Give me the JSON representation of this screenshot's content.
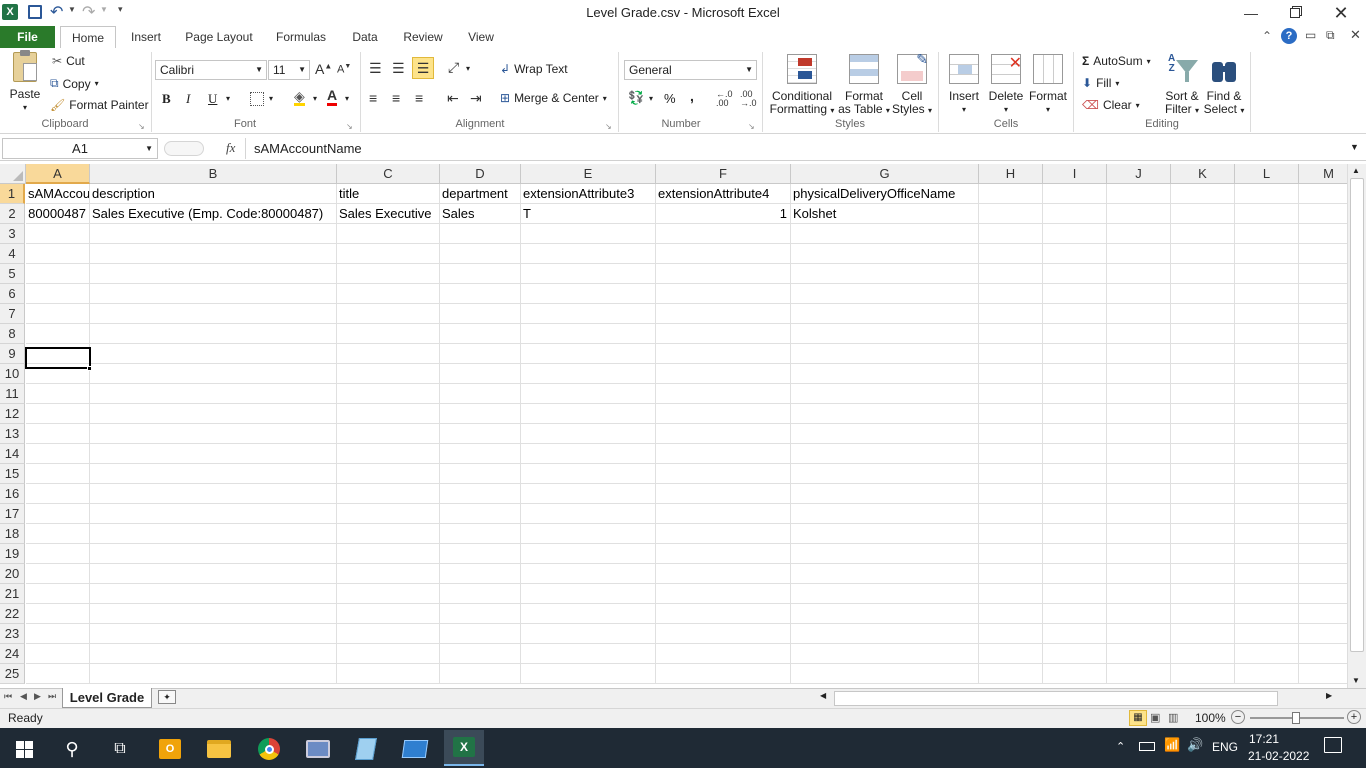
{
  "window": {
    "title": "Level Grade.csv  -  Microsoft Excel"
  },
  "tabs": [
    {
      "label": "File"
    },
    {
      "label": "Home"
    },
    {
      "label": "Insert"
    },
    {
      "label": "Page Layout"
    },
    {
      "label": "Formulas"
    },
    {
      "label": "Data"
    },
    {
      "label": "Review"
    },
    {
      "label": "View"
    }
  ],
  "ribbon": {
    "clipboard": {
      "paste": "Paste",
      "cut": "Cut",
      "copy": "Copy",
      "format_painter": "Format Painter",
      "label": "Clipboard"
    },
    "font": {
      "name": "Calibri",
      "size": "11",
      "bold": "B",
      "italic": "I",
      "underline": "U",
      "label": "Font"
    },
    "alignment": {
      "wrap": "Wrap Text",
      "merge": "Merge & Center",
      "label": "Alignment"
    },
    "number": {
      "format": "General",
      "percent": "%",
      "comma": ",",
      "label": "Number"
    },
    "styles": {
      "conditional": "Conditional",
      "conditional2": "Formatting",
      "format_table": "Format",
      "format_table2": "as Table",
      "cell_styles": "Cell",
      "cell_styles2": "Styles",
      "label": "Styles"
    },
    "cells": {
      "insert": "Insert",
      "delete": "Delete",
      "format": "Format",
      "label": "Cells"
    },
    "editing": {
      "autosum": "AutoSum",
      "fill": "Fill",
      "clear": "Clear",
      "sort": "Sort &",
      "sort2": "Filter",
      "find": "Find &",
      "find2": "Select",
      "label": "Editing"
    }
  },
  "formula_bar": {
    "name_box": "A1",
    "fx": "fx",
    "content": "sAMAccountName"
  },
  "columns": [
    "A",
    "B",
    "C",
    "D",
    "E",
    "F",
    "G",
    "H",
    "I",
    "J",
    "K",
    "L",
    "M"
  ],
  "rows": [
    "1",
    "2",
    "3",
    "4",
    "5",
    "6",
    "7",
    "8",
    "9",
    "10",
    "11",
    "12",
    "13",
    "14",
    "15",
    "16",
    "17",
    "18",
    "19",
    "20",
    "21",
    "22",
    "23",
    "24",
    "25"
  ],
  "cells": {
    "A1": "sAMAccou",
    "B1": "description",
    "C1": "title",
    "D1": "department",
    "E1": "extensionAttribute3",
    "F1": "extensionAttribute4",
    "G1": "physicalDeliveryOfficeName",
    "A2": "80000487",
    "B2": "Sales Executive (Emp. Code:80000487)",
    "C2": "Sales Executive",
    "D2": "Sales",
    "E2": "T",
    "F2": "1",
    "G2": "Kolshet"
  },
  "sheet": {
    "tab": "Level Grade"
  },
  "status": {
    "state": "Ready",
    "zoom": "100%"
  },
  "taskbar": {
    "lang": "ENG",
    "time": "17:21",
    "date": "21-02-2022"
  },
  "colors": {
    "excel_green": "#217346",
    "file_tab": "#2a7a2a",
    "taskbar": "#1f2a35",
    "selection": "#000000"
  }
}
